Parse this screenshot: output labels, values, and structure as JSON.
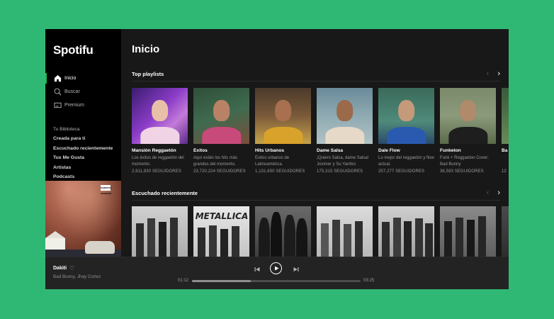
{
  "app": {
    "logo": "Spotifu"
  },
  "sidebar": {
    "nav": [
      {
        "label": "Inicio",
        "icon": "home-icon",
        "active": true
      },
      {
        "label": "Buscar",
        "icon": "search-icon",
        "active": false
      },
      {
        "label": "Premium",
        "icon": "premium-icon",
        "active": false
      }
    ],
    "library_label": "Tu Biblioteca",
    "library": [
      "Creada para ti",
      "Escuchado recientemente",
      "Tus Me Gusta",
      "Artistas",
      "Podcasts"
    ],
    "album_art_badge": "PARENTAL ADVISORY"
  },
  "main": {
    "title": "Inicio",
    "sections": [
      {
        "title": "Top playlists",
        "cards": [
          {
            "title": "Mansión Reggaetón",
            "desc": "Los éxitos de reggaetón del momento.",
            "sub": "2,611,830 SEGUIDORES"
          },
          {
            "title": "Éxitos",
            "desc": "Aquí están los hits más grandes del momento.",
            "sub": "23,720,224 SEGUIDORES"
          },
          {
            "title": "Hits Urbanos",
            "desc": "Éxitos urbanos de Latinoamérica.",
            "sub": "1,131,650 SEGUIDORES"
          },
          {
            "title": "Dame Salsa",
            "desc": "¡Quiero Salsa, dame Salsa! Joximer y Su Yambú",
            "sub": "175,315 SEGUIDORES"
          },
          {
            "title": "Dale Flow",
            "desc": "Lo mejor del reggaetón y flow actual.",
            "sub": "257,277 SEGUIDORES"
          },
          {
            "title": "Funketon",
            "desc": "Funk + Reggaeton Cover: Bad Bunny",
            "sub": "36,593 SEGUIDORES"
          },
          {
            "title": "Ba",
            "desc": "",
            "sub": "12"
          }
        ]
      },
      {
        "title": "Escuchado recientemente"
      }
    ]
  },
  "player": {
    "track": "Dakiti",
    "artist": "Bad Bunny, Jhay Cortez",
    "elapsed": "01:12",
    "total": "03:25",
    "progress": 0.35
  },
  "colors": {
    "accent": "#1db954",
    "background": "#2fb874",
    "panel": "#181818"
  }
}
